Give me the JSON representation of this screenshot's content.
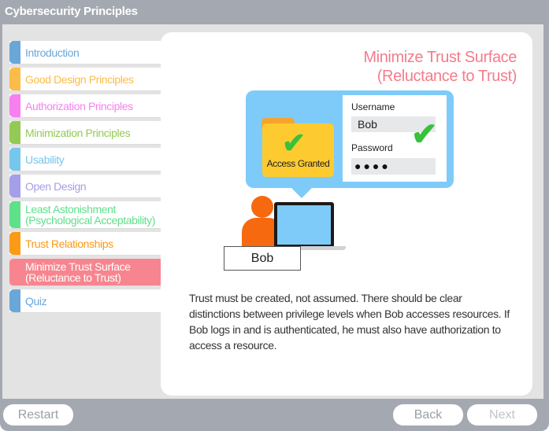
{
  "window": {
    "title": "Cybersecurity Principles"
  },
  "nav": {
    "items": [
      {
        "label": "Introduction",
        "color": "#6aa7d8",
        "active": false
      },
      {
        "label": "Good Design Principles",
        "color": "#fcbc48",
        "active": false
      },
      {
        "label": "Authorization Principles",
        "color": "#f77ff0",
        "active": false
      },
      {
        "label": "Minimization Principles",
        "color": "#94c955",
        "active": false
      },
      {
        "label": "Usability",
        "color": "#77c6ee",
        "active": false
      },
      {
        "label": "Open Design",
        "color": "#a59ee8",
        "active": false
      },
      {
        "label": "Least Astonishment\n(Psychological Acceptability)",
        "color": "#5fe08b",
        "active": false
      },
      {
        "label": "Trust Relationships",
        "color": "#fb9a16",
        "active": false
      },
      {
        "label": "Minimize Trust Surface\n(Reluctance to Trust)",
        "color": "#f7858f",
        "active": true
      },
      {
        "label": "Quiz",
        "color": "#6aa7d8",
        "active": false
      }
    ]
  },
  "content": {
    "heading": "Minimize Trust Surface\n(Reluctance to Trust)",
    "heading_color": "#f47c8c",
    "illustration": {
      "folder_label": "Access Granted",
      "username_label": "Username",
      "username_value": "Bob",
      "password_label": "Password",
      "password_value": "●●●●",
      "check_icon": "✔",
      "person_label": "Bob"
    },
    "body": "Trust must be created, not assumed. There should be clear distinctions between privilege levels when Bob accesses resources. If Bob logs in and is authenticated, he must also have authorization to access a resource."
  },
  "footer": {
    "restart_label": "Restart",
    "back_label": "Back",
    "next_label": "Next"
  }
}
